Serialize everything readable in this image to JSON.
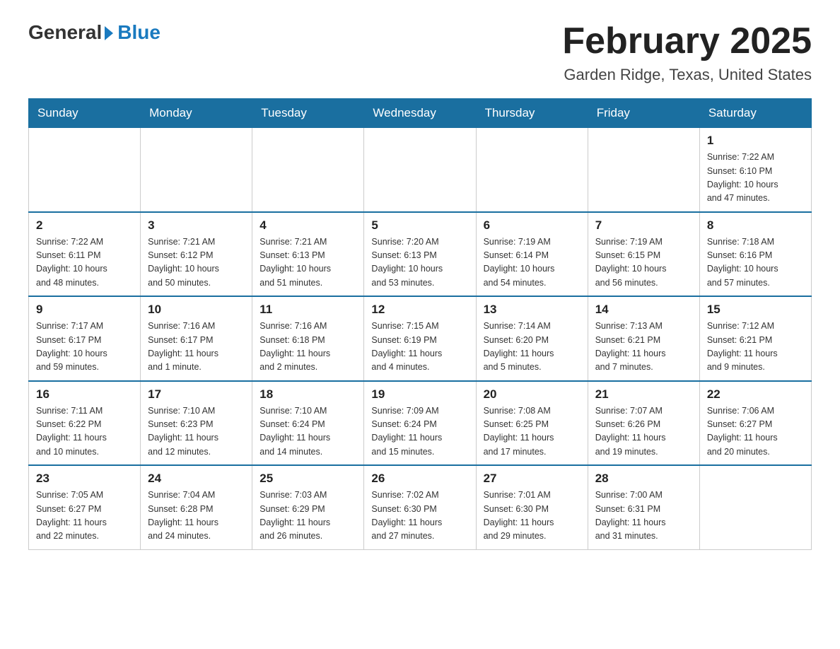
{
  "header": {
    "logo_general": "General",
    "logo_blue": "Blue",
    "title": "February 2025",
    "subtitle": "Garden Ridge, Texas, United States"
  },
  "weekdays": [
    "Sunday",
    "Monday",
    "Tuesday",
    "Wednesday",
    "Thursday",
    "Friday",
    "Saturday"
  ],
  "weeks": [
    [
      {
        "day": "",
        "info": ""
      },
      {
        "day": "",
        "info": ""
      },
      {
        "day": "",
        "info": ""
      },
      {
        "day": "",
        "info": ""
      },
      {
        "day": "",
        "info": ""
      },
      {
        "day": "",
        "info": ""
      },
      {
        "day": "1",
        "info": "Sunrise: 7:22 AM\nSunset: 6:10 PM\nDaylight: 10 hours\nand 47 minutes."
      }
    ],
    [
      {
        "day": "2",
        "info": "Sunrise: 7:22 AM\nSunset: 6:11 PM\nDaylight: 10 hours\nand 48 minutes."
      },
      {
        "day": "3",
        "info": "Sunrise: 7:21 AM\nSunset: 6:12 PM\nDaylight: 10 hours\nand 50 minutes."
      },
      {
        "day": "4",
        "info": "Sunrise: 7:21 AM\nSunset: 6:13 PM\nDaylight: 10 hours\nand 51 minutes."
      },
      {
        "day": "5",
        "info": "Sunrise: 7:20 AM\nSunset: 6:13 PM\nDaylight: 10 hours\nand 53 minutes."
      },
      {
        "day": "6",
        "info": "Sunrise: 7:19 AM\nSunset: 6:14 PM\nDaylight: 10 hours\nand 54 minutes."
      },
      {
        "day": "7",
        "info": "Sunrise: 7:19 AM\nSunset: 6:15 PM\nDaylight: 10 hours\nand 56 minutes."
      },
      {
        "day": "8",
        "info": "Sunrise: 7:18 AM\nSunset: 6:16 PM\nDaylight: 10 hours\nand 57 minutes."
      }
    ],
    [
      {
        "day": "9",
        "info": "Sunrise: 7:17 AM\nSunset: 6:17 PM\nDaylight: 10 hours\nand 59 minutes."
      },
      {
        "day": "10",
        "info": "Sunrise: 7:16 AM\nSunset: 6:17 PM\nDaylight: 11 hours\nand 1 minute."
      },
      {
        "day": "11",
        "info": "Sunrise: 7:16 AM\nSunset: 6:18 PM\nDaylight: 11 hours\nand 2 minutes."
      },
      {
        "day": "12",
        "info": "Sunrise: 7:15 AM\nSunset: 6:19 PM\nDaylight: 11 hours\nand 4 minutes."
      },
      {
        "day": "13",
        "info": "Sunrise: 7:14 AM\nSunset: 6:20 PM\nDaylight: 11 hours\nand 5 minutes."
      },
      {
        "day": "14",
        "info": "Sunrise: 7:13 AM\nSunset: 6:21 PM\nDaylight: 11 hours\nand 7 minutes."
      },
      {
        "day": "15",
        "info": "Sunrise: 7:12 AM\nSunset: 6:21 PM\nDaylight: 11 hours\nand 9 minutes."
      }
    ],
    [
      {
        "day": "16",
        "info": "Sunrise: 7:11 AM\nSunset: 6:22 PM\nDaylight: 11 hours\nand 10 minutes."
      },
      {
        "day": "17",
        "info": "Sunrise: 7:10 AM\nSunset: 6:23 PM\nDaylight: 11 hours\nand 12 minutes."
      },
      {
        "day": "18",
        "info": "Sunrise: 7:10 AM\nSunset: 6:24 PM\nDaylight: 11 hours\nand 14 minutes."
      },
      {
        "day": "19",
        "info": "Sunrise: 7:09 AM\nSunset: 6:24 PM\nDaylight: 11 hours\nand 15 minutes."
      },
      {
        "day": "20",
        "info": "Sunrise: 7:08 AM\nSunset: 6:25 PM\nDaylight: 11 hours\nand 17 minutes."
      },
      {
        "day": "21",
        "info": "Sunrise: 7:07 AM\nSunset: 6:26 PM\nDaylight: 11 hours\nand 19 minutes."
      },
      {
        "day": "22",
        "info": "Sunrise: 7:06 AM\nSunset: 6:27 PM\nDaylight: 11 hours\nand 20 minutes."
      }
    ],
    [
      {
        "day": "23",
        "info": "Sunrise: 7:05 AM\nSunset: 6:27 PM\nDaylight: 11 hours\nand 22 minutes."
      },
      {
        "day": "24",
        "info": "Sunrise: 7:04 AM\nSunset: 6:28 PM\nDaylight: 11 hours\nand 24 minutes."
      },
      {
        "day": "25",
        "info": "Sunrise: 7:03 AM\nSunset: 6:29 PM\nDaylight: 11 hours\nand 26 minutes."
      },
      {
        "day": "26",
        "info": "Sunrise: 7:02 AM\nSunset: 6:30 PM\nDaylight: 11 hours\nand 27 minutes."
      },
      {
        "day": "27",
        "info": "Sunrise: 7:01 AM\nSunset: 6:30 PM\nDaylight: 11 hours\nand 29 minutes."
      },
      {
        "day": "28",
        "info": "Sunrise: 7:00 AM\nSunset: 6:31 PM\nDaylight: 11 hours\nand 31 minutes."
      },
      {
        "day": "",
        "info": ""
      }
    ]
  ]
}
